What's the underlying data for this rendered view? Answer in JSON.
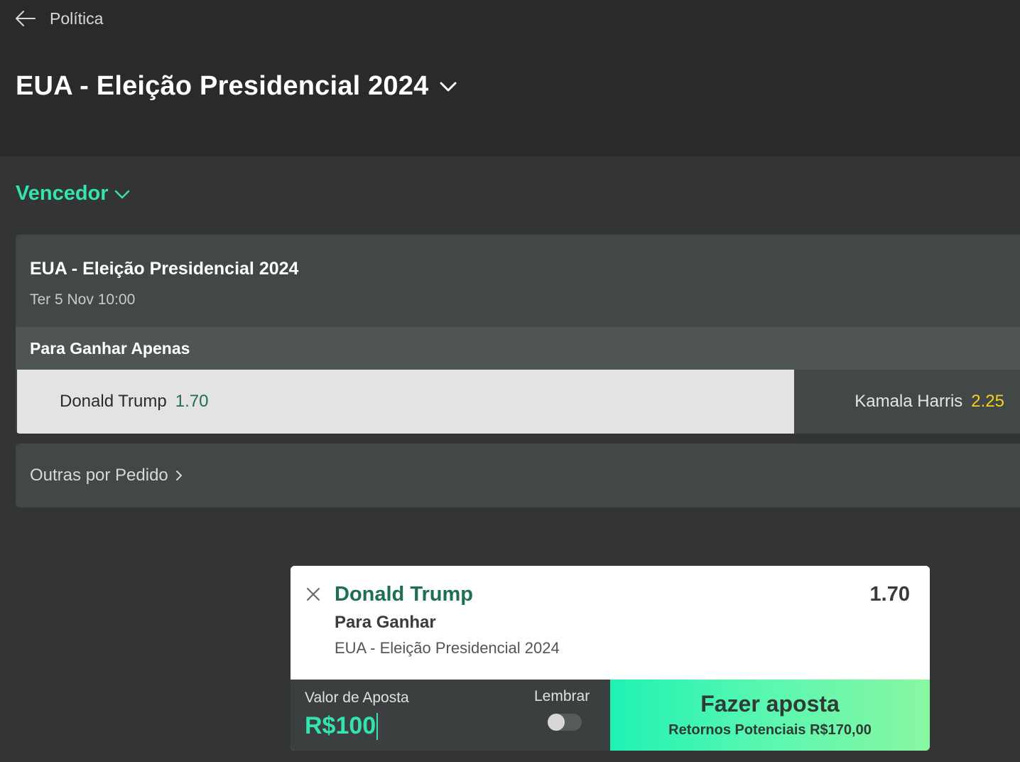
{
  "header": {
    "back_label": "Política",
    "page_title": "EUA - Eleição Presidencial 2024"
  },
  "market_selector": {
    "label": "Vencedor"
  },
  "event": {
    "title": "EUA - Eleição Presidencial 2024",
    "date": "Ter 5 Nov 10:00",
    "market_name": "Para Ganhar Apenas",
    "selections": [
      {
        "name": "Donald Trump",
        "odds": "1.70",
        "selected": true
      },
      {
        "name": "Kamala Harris",
        "odds": "2.25",
        "selected": false
      }
    ]
  },
  "other_markets": {
    "label": "Outras por Pedido"
  },
  "betslip": {
    "selection": "Donald Trump",
    "odds": "1.70",
    "market": "Para Ganhar",
    "event": "EUA - Eleição Presidencial 2024",
    "stake_label": "Valor de Aposta",
    "stake_value": "R$100",
    "remember_label": "Lembrar",
    "remember_on": false,
    "place_bet_label": "Fazer aposta",
    "potential_returns": "Retornos Potenciais R$170,00"
  },
  "colors": {
    "accent_green": "#33e3b0",
    "selected_odds_green": "#1d6f4f",
    "odds_yellow": "#f6d21b",
    "header_bg": "#2a2a2a",
    "page_bg": "#333434",
    "card_bg": "#424747"
  },
  "icons": {
    "back": "arrow-left-icon",
    "title_dropdown": "chevron-down-icon",
    "market_dropdown": "chevron-down-icon",
    "other_markets": "chevron-right-icon",
    "slip_close": "close-icon"
  }
}
